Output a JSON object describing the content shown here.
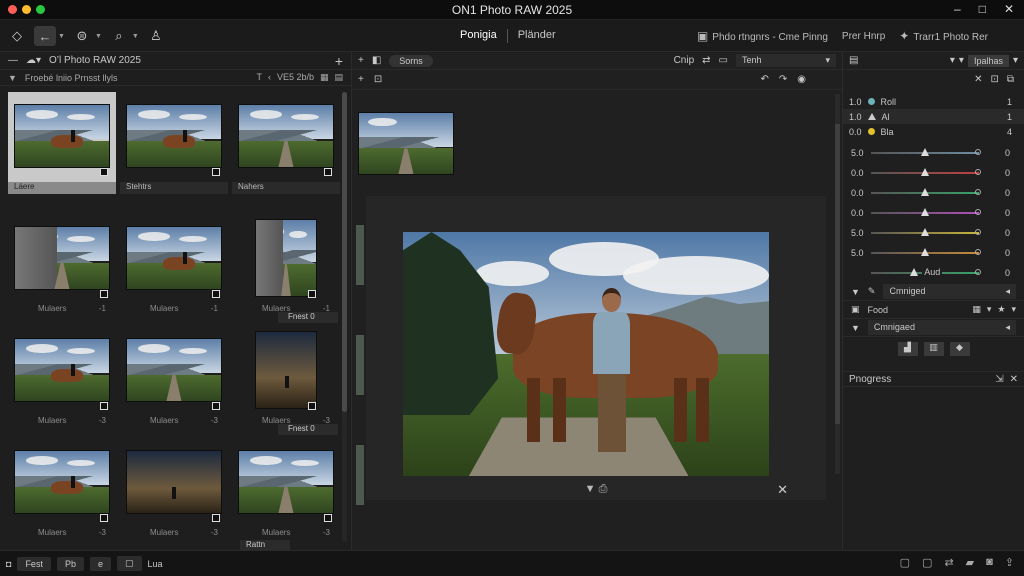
{
  "window": {
    "title": "ON1 Photo RAW 2025",
    "minimize": "–",
    "maximize": "□",
    "close": "✕"
  },
  "toolbar": {
    "modes": [
      "Ponigia",
      "Pländer"
    ],
    "right_items": [
      {
        "icon": "▣",
        "label": "Phdo rtngnrs - Cme Pinng"
      },
      {
        "icon": "",
        "label": "Prer Hnrp"
      },
      {
        "icon": "✦",
        "label": "Trarr1 Photo Rer"
      }
    ]
  },
  "browser": {
    "title": "O’l Photo RAW 2025",
    "sub_left": "Froebé lniio Prnsst llyls",
    "sub_right": "VE5 2b/b",
    "thumbs": [
      {
        "row": 0,
        "col": 0,
        "caption": "Láere",
        "type": "horse",
        "selected": true
      },
      {
        "row": 0,
        "col": 1,
        "caption": "Stehtrs",
        "type": "horse"
      },
      {
        "row": 0,
        "col": 2,
        "caption": "Nahers",
        "type": "landscape"
      },
      {
        "row": 1,
        "col": 0,
        "caption": "Mulaers",
        "num": "-1",
        "type": "rock"
      },
      {
        "row": 1,
        "col": 1,
        "caption": "Mulaers",
        "num": "-1",
        "type": "horse"
      },
      {
        "row": 1,
        "col": 2,
        "caption": "Mulaers",
        "num": "-1",
        "type": "rock"
      },
      {
        "row": 2,
        "col": 0,
        "caption": "Mulaers",
        "num": "-3",
        "type": "horse"
      },
      {
        "row": 2,
        "col": 1,
        "caption": "Mulaers",
        "num": "-3",
        "type": "road"
      },
      {
        "row": 2,
        "col": 2,
        "caption": "Mulaers",
        "num": "-3",
        "type": "sunset"
      },
      {
        "row": 3,
        "col": 0,
        "caption": "Mulaers",
        "num": "-3",
        "type": "horse"
      },
      {
        "row": 3,
        "col": 1,
        "caption": "Mulaers",
        "num": "-3",
        "type": "sunset"
      },
      {
        "row": 3,
        "col": 2,
        "caption": "Mulaers",
        "num": "-3",
        "type": "landscape"
      }
    ],
    "row_tags": [
      "Fnest 0",
      "Fnest 0"
    ],
    "bottom_tag": "Rattn"
  },
  "middle": {
    "pill": "Sorns",
    "chip_label": "Cnip",
    "dropdown": "Tenh",
    "viewer_ctrl": "▼ ⎙"
  },
  "panel": {
    "tab_label": "Ipalhas",
    "hist": [
      {
        "label": "Roll",
        "num": "1.0",
        "val": "1",
        "color": "#6ab3b8"
      },
      {
        "label": "Al",
        "num": "1.0",
        "val": "1",
        "color": "",
        "hl": true
      },
      {
        "label": "Bla",
        "num": "0.0",
        "val": "4",
        "color": "#e2c12b"
      }
    ],
    "sliders": [
      {
        "label": "5.0",
        "val": "0",
        "color": "#6e8ca0",
        "pos": 0.5
      },
      {
        "label": "0.0",
        "val": "0",
        "color": "#c04040",
        "pos": 0.5
      },
      {
        "label": "0.0",
        "val": "0",
        "color": "#3aa36a",
        "pos": 0.5
      },
      {
        "label": "0.0",
        "val": "0",
        "color": "#b04fb8",
        "pos": 0.5
      },
      {
        "label": "5.0",
        "val": "0",
        "color": "#c9b43a",
        "pos": 0.5
      },
      {
        "label": "5.0",
        "val": "0",
        "color": "#c98a3a",
        "pos": 0.5
      },
      {
        "label": "",
        "val": "0",
        "color": "#3aa36a",
        "pos": 0.4,
        "inline": "Aud"
      }
    ],
    "section1": "Cmniged",
    "section2_label": "Food",
    "section3": "Cmnigaed",
    "progress": "Pnogress"
  },
  "status": {
    "left": [
      "Fest",
      "Pb",
      "e"
    ],
    "label": "Lua"
  }
}
